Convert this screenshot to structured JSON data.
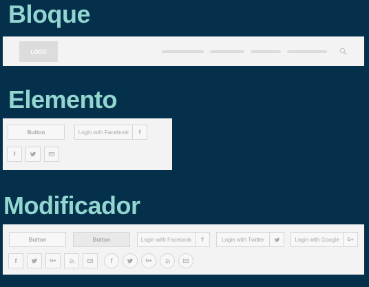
{
  "colors": {
    "background": "#05304c",
    "heading": "#93d6d0",
    "panel": "#f3f3f4",
    "placeholder": "#dcdcdd",
    "button_text": "#a9a9ad"
  },
  "sections": {
    "block": {
      "title": "Bloque"
    },
    "element": {
      "title": "Elemento"
    },
    "modifier": {
      "title": "Modificador"
    }
  },
  "block": {
    "logo_label": "LOGO",
    "icon": "search-icon"
  },
  "element": {
    "button_label": "Button",
    "facebook_login": {
      "label": "Login with Facebook",
      "glyph": "f"
    },
    "icon_buttons": [
      {
        "icon": "facebook-icon",
        "glyph": "f"
      },
      {
        "icon": "twitter-icon"
      },
      {
        "icon": "email-icon"
      }
    ]
  },
  "modifier": {
    "button_label": "Button",
    "button_filled_label": "Button",
    "facebook_login": {
      "label": "Login with Facebook",
      "glyph": "f"
    },
    "twitter_login": {
      "label": "Login with Twitter",
      "icon": "twitter-icon"
    },
    "google_login": {
      "label": "Login with Google",
      "glyph": "G+"
    },
    "square_icons": [
      {
        "icon": "facebook-icon",
        "glyph": "f"
      },
      {
        "icon": "twitter-icon"
      },
      {
        "icon": "google-plus-icon",
        "glyph": "G+"
      },
      {
        "icon": "rss-icon"
      },
      {
        "icon": "email-icon"
      }
    ],
    "round_icons": [
      {
        "icon": "facebook-icon",
        "glyph": "f"
      },
      {
        "icon": "twitter-icon"
      },
      {
        "icon": "google-plus-icon",
        "glyph": "G+"
      },
      {
        "icon": "rss-icon"
      },
      {
        "icon": "email-icon"
      }
    ]
  }
}
